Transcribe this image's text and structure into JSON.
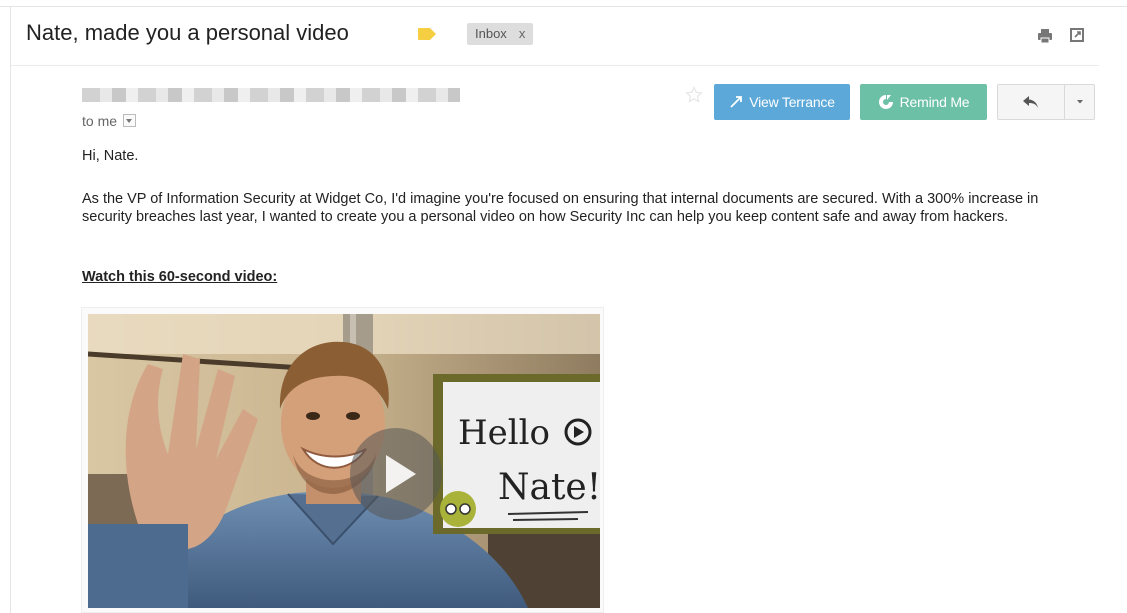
{
  "email": {
    "subject": "Nate, made you a personal video",
    "label_chip": "Inbox",
    "label_chip_close": "x",
    "recipient": "to me",
    "greeting": "Hi, Nate.",
    "paragraph": "As the VP of Information Security at Widget Co, I'd imagine you're focused on ensuring that internal documents are secured. With a 300% increase in security breaches last year, I wanted to create you a personal video on how Security Inc can help you keep content safe and away from hackers.",
    "video_cta": "Watch this 60-second video:",
    "video_sign": {
      "line1": "Hello",
      "line2": "Nate!"
    }
  },
  "toolbar": {
    "view_label": "View Terrance",
    "remind_label": "Remind Me"
  },
  "icons": {
    "label": "label-tag-icon",
    "print": "print-icon",
    "new_window": "open-new-window-icon",
    "star": "star-icon",
    "view": "expand-arrow-icon",
    "remind": "remind-icon",
    "reply": "reply-icon",
    "more": "chevron-down-icon",
    "play": "play-icon"
  },
  "colors": {
    "view_button": "#5ba8d9",
    "remind_button": "#6cc0a5",
    "label_tag": "#f5ce42",
    "chip_bg": "#dddddd"
  }
}
